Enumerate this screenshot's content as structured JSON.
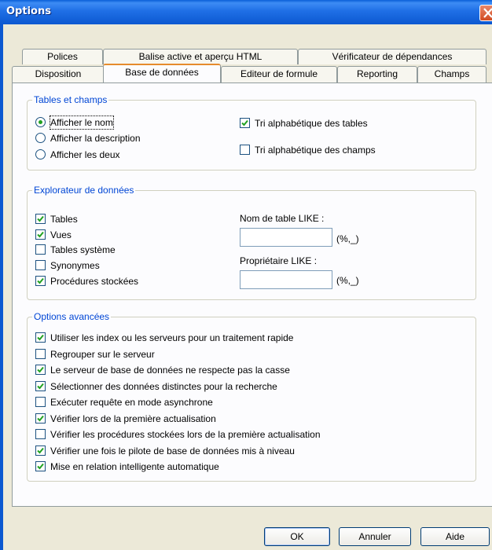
{
  "window": {
    "title": "Options"
  },
  "tabs_back": [
    {
      "label": "Polices"
    },
    {
      "label": "Balise active et aperçu HTML"
    },
    {
      "label": "Vérificateur de dépendances"
    }
  ],
  "tabs_front": [
    {
      "label": "Disposition"
    },
    {
      "label": "Base de données",
      "active": true
    },
    {
      "label": "Editeur de formule"
    },
    {
      "label": "Reporting"
    },
    {
      "label": "Champs"
    }
  ],
  "tables_champs": {
    "title": "Tables et champs",
    "radios": [
      {
        "label": "Afficher le nom",
        "checked": true
      },
      {
        "label": "Afficher la description",
        "checked": false
      },
      {
        "label": "Afficher les deux",
        "checked": false
      }
    ],
    "checks": [
      {
        "label": "Tri alphabétique des tables",
        "checked": true
      },
      {
        "label": "Tri alphabétique des champs",
        "checked": false
      }
    ]
  },
  "explorateur": {
    "title": "Explorateur de données",
    "checks": [
      {
        "label": "Tables",
        "checked": true
      },
      {
        "label": "Vues",
        "checked": true
      },
      {
        "label": "Tables système",
        "checked": false
      },
      {
        "label": "Synonymes",
        "checked": false
      },
      {
        "label": "Procédures stockées",
        "checked": true
      }
    ],
    "table_like": {
      "label": "Nom de table LIKE :",
      "value": "",
      "hint": "(%,_)"
    },
    "owner_like": {
      "label": "Propriétaire LIKE :",
      "value": "",
      "hint": "(%,_)"
    }
  },
  "avancees": {
    "title": "Options avancées",
    "checks": [
      {
        "label": "Utiliser les index ou les serveurs pour un traitement rapide",
        "checked": true
      },
      {
        "label": "Regrouper sur le serveur",
        "checked": false
      },
      {
        "label": "Le serveur de base de données ne respecte pas la casse",
        "checked": true
      },
      {
        "label": "Sélectionner des données distinctes pour la recherche",
        "checked": true
      },
      {
        "label": "Exécuter requête en mode asynchrone",
        "checked": false
      },
      {
        "label": "Vérifier lors de la première actualisation",
        "checked": true
      },
      {
        "label": "Vérifier les procédures stockées lors de la première actualisation",
        "checked": false
      },
      {
        "label": "Vérifier une fois le pilote de base de données mis à niveau",
        "checked": true
      },
      {
        "label": "Mise en relation intelligente automatique",
        "checked": true
      }
    ]
  },
  "buttons": {
    "ok": "OK",
    "cancel": "Annuler",
    "help": "Aide"
  },
  "colors": {
    "title_bar": "#0c58d0",
    "group_title": "#0046d5",
    "check": "#21a121",
    "active_tab_accent": "#e68b2c"
  }
}
